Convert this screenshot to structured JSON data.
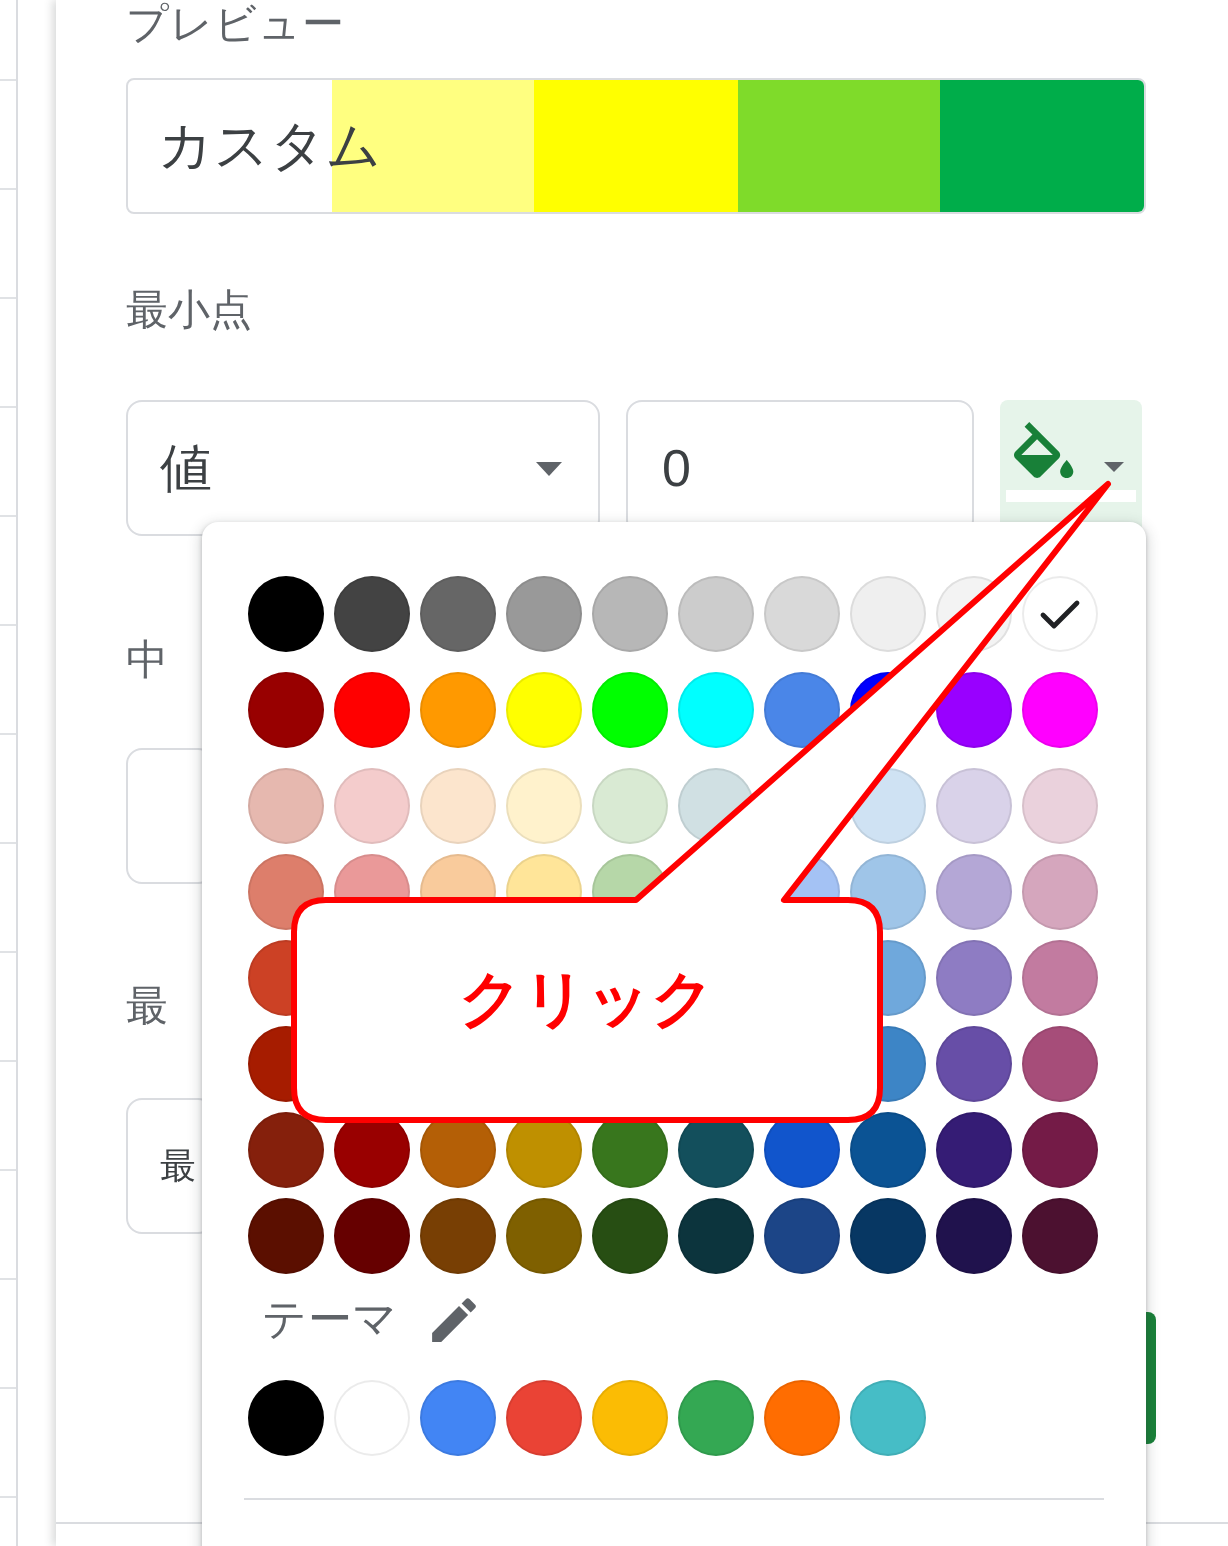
{
  "preview": {
    "label": "プレビュー",
    "text": "カスタム",
    "segments": [
      {
        "color": "#ffff80"
      },
      {
        "color": "#ffff00"
      },
      {
        "color": "#7fdb2a"
      },
      {
        "color": "#00ad4a"
      }
    ]
  },
  "min_point": {
    "label": "最小点",
    "dropdown": "値",
    "value": "0"
  },
  "section_2": {
    "label": "中"
  },
  "section_3": {
    "label": "最",
    "dropdown": "最"
  },
  "color_picker": {
    "rows": [
      [
        {
          "color": "#000000",
          "selected": false
        },
        {
          "color": "#434343",
          "selected": false
        },
        {
          "color": "#666666",
          "selected": false
        },
        {
          "color": "#999999",
          "selected": false
        },
        {
          "color": "#b7b7b7",
          "selected": false
        },
        {
          "color": "#cccccc",
          "selected": false
        },
        {
          "color": "#d9d9d9",
          "selected": false
        },
        {
          "color": "#efefef",
          "selected": false
        },
        {
          "color": "#f3f3f3",
          "selected": false
        },
        {
          "color": "#ffffff",
          "selected": true
        }
      ],
      [
        {
          "color": "#980000",
          "selected": false
        },
        {
          "color": "#ff0000",
          "selected": false
        },
        {
          "color": "#ff9900",
          "selected": false
        },
        {
          "color": "#ffff00",
          "selected": false
        },
        {
          "color": "#00ff00",
          "selected": false
        },
        {
          "color": "#00ffff",
          "selected": false
        },
        {
          "color": "#4a86e8",
          "selected": false
        },
        {
          "color": "#0000ff"
        },
        {
          "color": "#9900ff",
          "selected": false
        },
        {
          "color": "#ff00ff",
          "selected": false
        }
      ],
      [
        {
          "color": "#e6b8af",
          "selected": false
        },
        {
          "color": "#f4cccc",
          "selected": false
        },
        {
          "color": "#fce5cd",
          "selected": false
        },
        {
          "color": "#fff2cc",
          "selected": false
        },
        {
          "color": "#d9ead3",
          "selected": false
        },
        {
          "color": "#d0e0e3",
          "selected": false
        },
        null,
        {
          "color": "#cfe2f3",
          "selected": false
        },
        {
          "color": "#d9d2e9",
          "selected": false
        },
        {
          "color": "#ead1dc",
          "selected": false
        }
      ],
      [
        {
          "color": "#dd7e6b",
          "selected": false
        },
        {
          "color": "#ea9999",
          "selected": false
        },
        {
          "color": "#f9cb9c",
          "selected": false
        },
        {
          "color": "#ffe599",
          "selected": false
        },
        {
          "color": "#b6d7a8",
          "selected": false
        },
        null,
        {
          "color": "#a4c2f4",
          "selected": false
        },
        {
          "color": "#9fc5e8",
          "selected": false
        },
        {
          "color": "#b4a7d6",
          "selected": false
        },
        {
          "color": "#d5a6bd",
          "selected": false
        }
      ],
      [
        {
          "color": "#cc4125",
          "selected": false
        },
        null,
        null,
        null,
        null,
        null,
        null,
        {
          "color": "#6fa8dc",
          "selected": false
        },
        {
          "color": "#8e7cc3",
          "selected": false
        },
        {
          "color": "#c27ba0",
          "selected": false
        }
      ],
      [
        {
          "color": "#a61c00",
          "selected": false
        },
        null,
        null,
        null,
        null,
        null,
        null,
        {
          "color": "#3d85c6",
          "selected": false
        },
        {
          "color": "#674ea7",
          "selected": false
        },
        {
          "color": "#a64d79",
          "selected": false
        }
      ],
      [
        {
          "color": "#85200c",
          "selected": false
        },
        {
          "color": "#990000",
          "selected": false
        },
        {
          "color": "#b45f06",
          "selected": false
        },
        {
          "color": "#bf9000",
          "selected": false
        },
        {
          "color": "#38761d",
          "selected": false
        },
        {
          "color": "#134f5c",
          "selected": false
        },
        {
          "color": "#1155cc",
          "selected": false
        },
        {
          "color": "#0b5394",
          "selected": false
        },
        {
          "color": "#351c75",
          "selected": false
        },
        {
          "color": "#741b47",
          "selected": false
        }
      ],
      [
        {
          "color": "#5b0f00",
          "selected": false
        },
        {
          "color": "#660000",
          "selected": false
        },
        {
          "color": "#783f04",
          "selected": false
        },
        {
          "color": "#7f6000",
          "selected": false
        },
        {
          "color": "#274e13",
          "selected": false
        },
        {
          "color": "#0c343d",
          "selected": false
        },
        {
          "color": "#1c4587",
          "selected": false
        },
        {
          "color": "#073763",
          "selected": false
        },
        {
          "color": "#20124d",
          "selected": false
        },
        {
          "color": "#4c1130",
          "selected": false
        }
      ]
    ],
    "theme_label": "テーマ",
    "theme": [
      {
        "color": "#000000",
        "selected": false
      },
      {
        "color": "#ffffff",
        "selected": false
      },
      {
        "color": "#4285f4",
        "selected": false
      },
      {
        "color": "#ea4335",
        "selected": false
      },
      {
        "color": "#fbbc04",
        "selected": false
      },
      {
        "color": "#34a853",
        "selected": false
      },
      {
        "color": "#ff6d01",
        "selected": false
      },
      {
        "color": "#46bdc6",
        "selected": false
      }
    ]
  },
  "callout": {
    "text": "クリック"
  }
}
